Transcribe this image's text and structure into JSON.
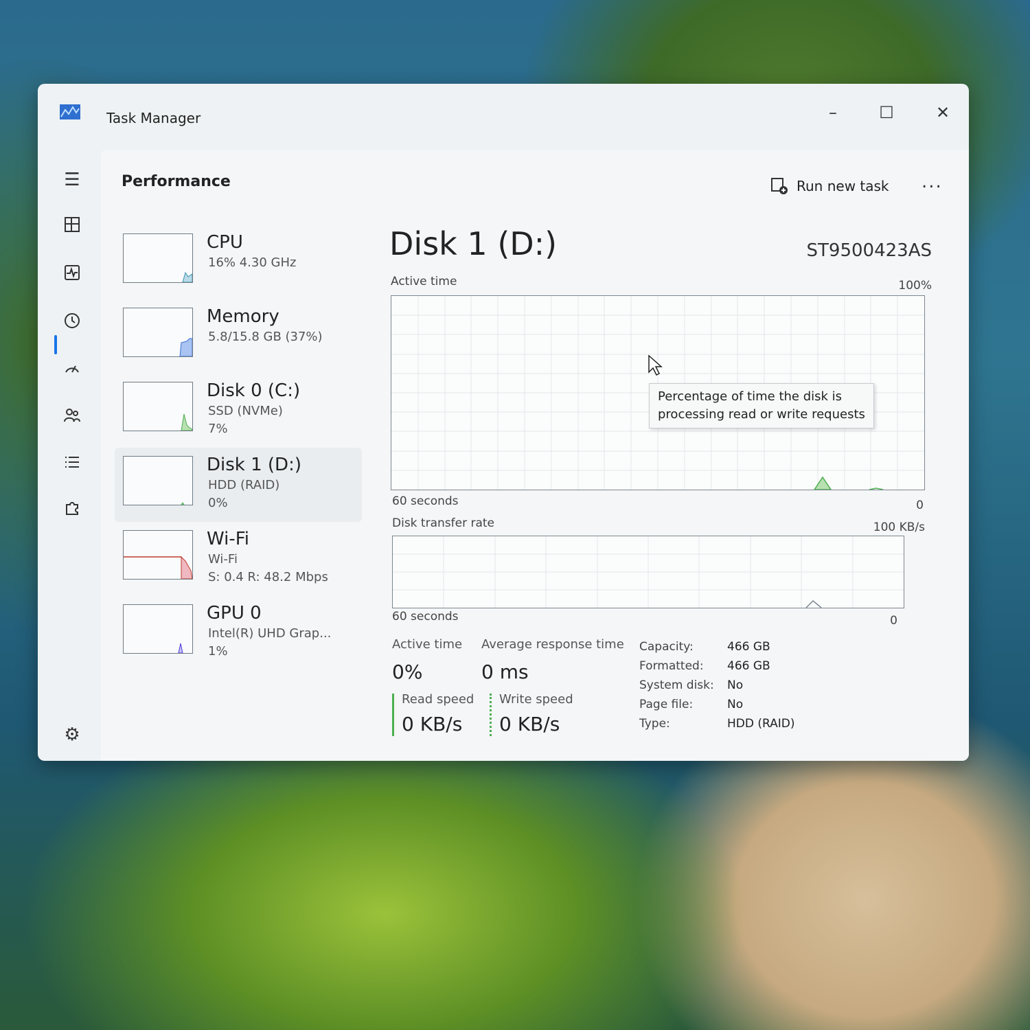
{
  "window": {
    "title": "Task Manager"
  },
  "header": {
    "title": "Performance",
    "run_task_label": "Run new task",
    "more_label": "..."
  },
  "resources": [
    {
      "name": "CPU",
      "lines": [
        "16% 4.30 GHz"
      ]
    },
    {
      "name": "Memory",
      "lines": [
        "5.8/15.8 GB (37%)"
      ]
    },
    {
      "name": "Disk 0 (C:)",
      "lines": [
        "SSD (NVMe)",
        "7%"
      ]
    },
    {
      "name": "Disk 1 (D:)",
      "lines": [
        "HDD (RAID)",
        "0%"
      ]
    },
    {
      "name": "Wi-Fi",
      "lines": [
        "Wi-Fi",
        "S: 0.4 R: 48.2 Mbps"
      ]
    },
    {
      "name": "GPU 0",
      "lines": [
        "Intel(R) UHD Grap...",
        "1%"
      ]
    }
  ],
  "detail": {
    "title": "Disk 1 (D:)",
    "model": "ST9500423AS",
    "active_time_graph": {
      "label": "Active time",
      "max": "100%",
      "duration": "60 seconds",
      "min": "0"
    },
    "transfer_graph": {
      "label": "Disk transfer rate",
      "max": "100 KB/s",
      "duration": "60 seconds",
      "min": "0"
    },
    "tooltip": {
      "line1": "Percentage of time the disk is",
      "line2": "processing read or write requests"
    },
    "stats": {
      "active_time_label": "Active time",
      "active_time_value": "0%",
      "avg_response_label": "Average response time",
      "avg_response_value": "0 ms",
      "read_label": "Read speed",
      "read_value": "0 KB/s",
      "write_label": "Write speed",
      "write_value": "0 KB/s"
    },
    "properties": [
      {
        "label": "Capacity:",
        "value": "466 GB"
      },
      {
        "label": "Formatted:",
        "value": "466 GB"
      },
      {
        "label": "System disk:",
        "value": "No"
      },
      {
        "label": "Page file:",
        "value": "No"
      },
      {
        "label": "Type:",
        "value": "HDD (RAID)"
      }
    ]
  },
  "colors": {
    "disk_accent": "#4caf50",
    "memory_accent": "#3b6fd8",
    "wifi_accent": "#c0392b",
    "gpu_accent": "#4a3bd8",
    "nav_active": "#1a73e8"
  }
}
